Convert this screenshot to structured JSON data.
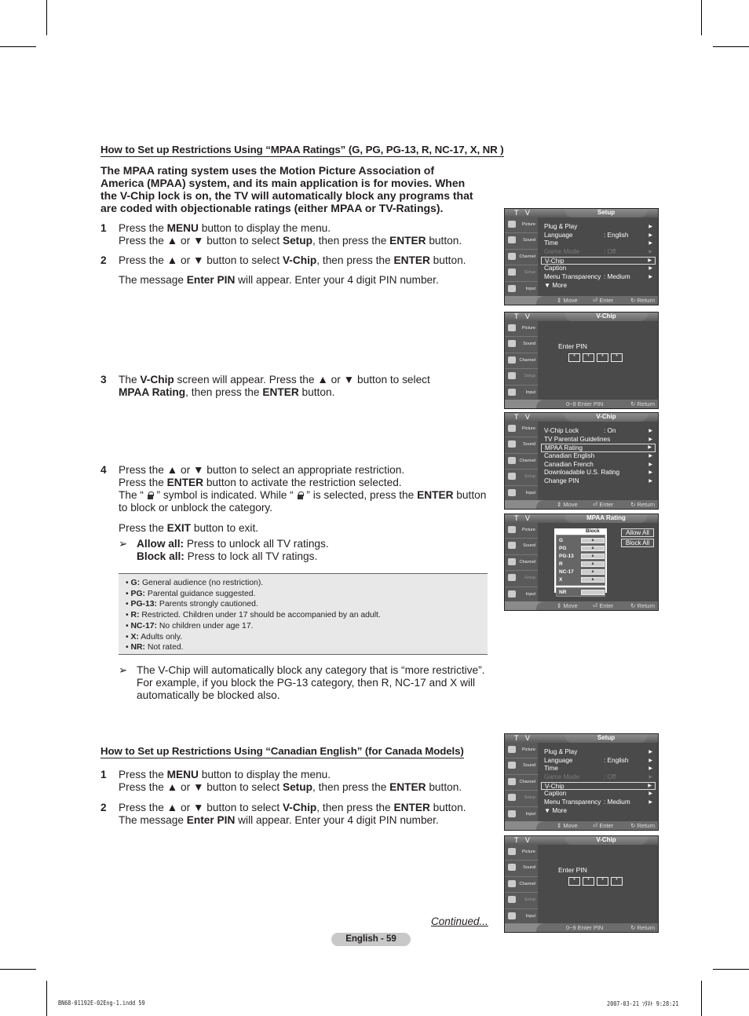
{
  "section1": {
    "title": "How to Set up Restrictions Using “MPAA Ratings” (G, PG, PG-13, R, NC-17, X, NR )",
    "intro": "The MPAA rating system uses the Motion Picture Association of America (MPAA) system, and its main application is for movies. When the V-Chip lock is on, the TV will automatically block any programs that are coded with objectionable ratings (either MPAA or TV-Ratings).",
    "steps": [
      {
        "num": "1",
        "line1_a": "Press the ",
        "line1_b": "MENU",
        "line1_c": " button to display the menu.",
        "line2_a": "Press the ▲ or ▼ button to select ",
        "line2_b": "Setup",
        "line2_c": ", then press the ",
        "line2_d": "ENTER",
        "line2_e": " button."
      },
      {
        "num": "2",
        "a": "Press the ▲ or ▼ button to select ",
        "b": "V-Chip",
        "c": ", then press the ",
        "d": "ENTER",
        "e": " button.",
        "msg_a": "The message ",
        "msg_b": "Enter PIN",
        "msg_c": " will appear. Enter your 4 digit PIN number."
      },
      {
        "num": "3",
        "a": "The ",
        "b": "V-Chip",
        "c": " screen will appear. Press the ▲ or ▼ button to select ",
        "d": "MPAA Rating",
        "e": ", then press the ",
        "f": "ENTER",
        "g": " button."
      },
      {
        "num": "4",
        "l1": "Press the ▲ or ▼ button to select an appropriate restriction.",
        "l2_a": "Press the ",
        "l2_b": "ENTER",
        "l2_c": " button to activate the restriction selected.",
        "l3_a": "The “ ",
        "l3_b": " ” symbol is indicated. While “ ",
        "l3_c": " ” is selected, press the ",
        "l3_d": "ENTER",
        "l3_e": " button to block or unblock the category.",
        "exit_a": "Press the ",
        "exit_b": "EXIT",
        "exit_c": " button to exit."
      }
    ],
    "note_arrow": "➢",
    "allow_all_label": "Allow all:",
    "allow_all_text": " Press to unlock all TV ratings.",
    "block_all_label": "Block all:",
    "block_all_text": " Press to lock all TV ratings.",
    "ratings": [
      {
        "code": "G:",
        "desc": " General audience (no restriction)."
      },
      {
        "code": "PG:",
        "desc": " Parental guidance suggested."
      },
      {
        "code": "PG-13:",
        "desc": " Parents strongly cautioned."
      },
      {
        "code": "R:",
        "desc": " Restricted. Children under 17 should be accompanied by an adult."
      },
      {
        "code": "NC-17:",
        "desc": " No children under age 17."
      },
      {
        "code": "X:",
        "desc": " Adults only."
      },
      {
        "code": "NR:",
        "desc": " Not rated."
      }
    ],
    "auto_block_note": "The V-Chip will automatically block any category that is “more restrictive”. For example, if you block the PG-13 category, then R, NC-17 and X will automatically be blocked also."
  },
  "section2": {
    "title": "How to Set up Restrictions Using “Canadian English” (for Canada Models)",
    "steps": [
      {
        "num": "1",
        "line1_a": "Press the ",
        "line1_b": "MENU",
        "line1_c": " button to display the menu.",
        "line2_a": "Press the ▲ or ▼ button to select ",
        "line2_b": "Setup",
        "line2_c": ", then press the ",
        "line2_d": "ENTER",
        "line2_e": " button."
      },
      {
        "num": "2",
        "a": "Press the ▲ or ▼ button to select ",
        "b": "V-Chip",
        "c": ", then press the ",
        "d": "ENTER",
        "e": " button.",
        "msg_a": "The message ",
        "msg_b": "Enter PIN",
        "msg_c": " will appear. Enter your 4 digit PIN number."
      }
    ]
  },
  "tv": {
    "label": "T V",
    "sidebar": [
      "Picture",
      "Sound",
      "Channel",
      "Setup",
      "Input"
    ],
    "hint_move": "⇕ Move",
    "hint_enter": "⏎ Enter",
    "hint_return": "↻ Return",
    "hint_pin": "0~9 Enter PIN",
    "setup": {
      "title": "Setup",
      "items": [
        {
          "label": "Plug & Play",
          "value": ""
        },
        {
          "label": "Language",
          "value": ": English"
        },
        {
          "label": "Time",
          "value": ""
        },
        {
          "label": "Game Mode",
          "value": ": Off"
        },
        {
          "label": "V-Chip",
          "value": ""
        },
        {
          "label": "Caption",
          "value": ""
        },
        {
          "label": "Menu Transparency",
          "value": ": Medium"
        },
        {
          "label": "▼ More",
          "value": ""
        }
      ]
    },
    "pin": {
      "title": "V-Chip",
      "label": "Enter PIN",
      "boxes": [
        "*",
        "*",
        "*",
        "*"
      ]
    },
    "vchip": {
      "title": "V-Chip",
      "items": [
        {
          "label": "V-Chip Lock",
          "value": ": On"
        },
        {
          "label": "TV Parental Guidelines",
          "value": ""
        },
        {
          "label": "MPAA Rating",
          "value": ""
        },
        {
          "label": "Canadian English",
          "value": ""
        },
        {
          "label": "Canadian French",
          "value": ""
        },
        {
          "label": "Downloadable U.S. Rating",
          "value": ""
        },
        {
          "label": "Change PIN",
          "value": ""
        }
      ]
    },
    "mpaa": {
      "title": "MPAA Rating",
      "column": "Block",
      "rows": [
        "G",
        "PG",
        "PG-13",
        "R",
        "NC-17",
        "X"
      ],
      "nr": "NR",
      "allow_all": "Allow All",
      "block_all": "Block All"
    }
  },
  "footer": {
    "continued": "Continued...",
    "page": "English - 59",
    "file": "BN68-01192E-02Eng-1.indd   59",
    "stamp": "2007-03-21   ｿﾀﾈﾄ 9:28:21"
  }
}
